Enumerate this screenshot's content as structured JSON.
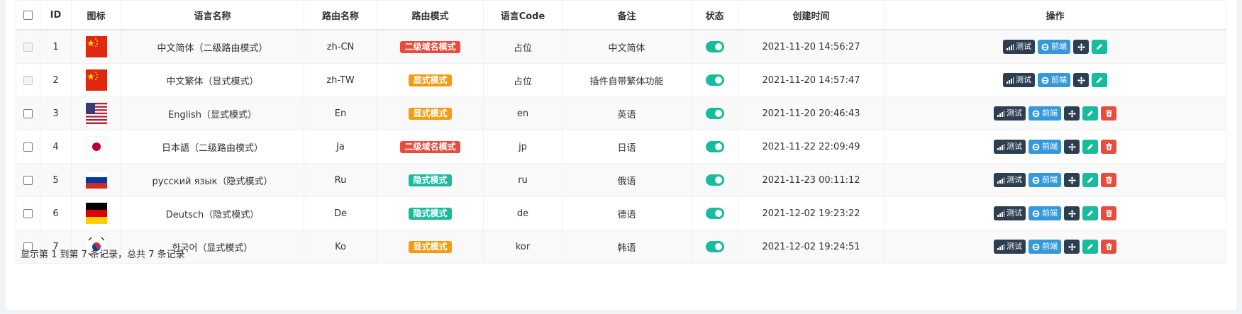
{
  "colors": {
    "danger": "#e74c3c",
    "warning": "#f39c12",
    "success": "#18bc9c",
    "dark": "#2c3e50",
    "info": "#3498db",
    "switch_on": "#18bc9c"
  },
  "table": {
    "headers": {
      "id": "ID",
      "icon": "图标",
      "name": "语言名称",
      "route_name": "路由名称",
      "route_mode": "路由模式",
      "code": "语言Code",
      "remark": "备注",
      "status": "状态",
      "created": "创建时间",
      "actions": "操作"
    },
    "buttons": {
      "test": "测试",
      "frontend": "前端",
      "drag_icon": "arrows-icon",
      "edit_icon": "pencil-icon",
      "delete_icon": "trash-icon"
    },
    "rows": [
      {
        "id": "1",
        "flag": "cn",
        "name": "中文简体（二级路由模式）",
        "route_name": "zh-CN",
        "mode": "二级域名模式",
        "mode_color": "#e74c3c",
        "code": "占位",
        "remark": "中文简体",
        "created": "2021-11-20 14:56:27",
        "checkbox_disabled": true,
        "deletable": false
      },
      {
        "id": "2",
        "flag": "cn",
        "name": "中文繁体（显式模式）",
        "route_name": "zh-TW",
        "mode": "显式模式",
        "mode_color": "#f39c12",
        "code": "占位",
        "remark": "插件自带繁体功能",
        "created": "2021-11-20 14:57:47",
        "checkbox_disabled": true,
        "deletable": false
      },
      {
        "id": "3",
        "flag": "us",
        "name": "English（显式模式）",
        "route_name": "En",
        "mode": "显式模式",
        "mode_color": "#f39c12",
        "code": "en",
        "remark": "英语",
        "created": "2021-11-20 20:46:43",
        "checkbox_disabled": false,
        "deletable": true
      },
      {
        "id": "4",
        "flag": "jp",
        "name": "日本語（二级路由模式）",
        "route_name": "Ja",
        "mode": "二级域名模式",
        "mode_color": "#e74c3c",
        "code": "jp",
        "remark": "日语",
        "created": "2021-11-22 22:09:49",
        "checkbox_disabled": false,
        "deletable": true
      },
      {
        "id": "5",
        "flag": "ru",
        "name": "русский язык（隐式模式）",
        "route_name": "Ru",
        "mode": "隐式模式",
        "mode_color": "#18bc9c",
        "code": "ru",
        "remark": "俄语",
        "created": "2021-11-23 00:11:12",
        "checkbox_disabled": false,
        "deletable": true
      },
      {
        "id": "6",
        "flag": "de",
        "name": "Deutsch（隐式模式）",
        "route_name": "De",
        "mode": "隐式模式",
        "mode_color": "#18bc9c",
        "code": "de",
        "remark": "德语",
        "created": "2021-12-02 19:23:22",
        "checkbox_disabled": false,
        "deletable": true
      },
      {
        "id": "7",
        "flag": "kr",
        "name": "한국어（显式模式）",
        "route_name": "Ko",
        "mode": "显式模式",
        "mode_color": "#f39c12",
        "code": "kor",
        "remark": "韩语",
        "created": "2021-12-02 19:24:51",
        "checkbox_disabled": false,
        "deletable": true
      }
    ]
  },
  "pagination": {
    "info": "显示第 1 到第 7 条记录，总共 7 条记录"
  }
}
